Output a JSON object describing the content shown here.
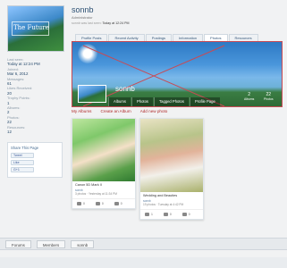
{
  "sidebar": {
    "avatar_text": "The Future",
    "stats": [
      {
        "label": "Last seen:",
        "value": "Today at 12:24 PM"
      },
      {
        "label": "Joined:",
        "value": "Mar 6, 2012"
      },
      {
        "label": "Messages:",
        "value": "61"
      },
      {
        "label": "Likes Received:",
        "value": "20"
      },
      {
        "label": "Trophy Points:",
        "value": "1"
      },
      {
        "label": "Albums:",
        "value": "2"
      },
      {
        "label": "Photos:",
        "value": "22"
      },
      {
        "label": "Resources:",
        "value": "12"
      }
    ],
    "share": {
      "title": "Share This Page",
      "buttons": [
        "Tweet",
        "Like",
        "G+1"
      ]
    }
  },
  "profile": {
    "username": "sonnb",
    "role": "Administrator",
    "last_seen_prefix": "sonnb was last seen:",
    "last_seen_value": "Today at 12:24 PM"
  },
  "tabs": [
    "Profile Posts",
    "Recent Activity",
    "Postings",
    "Information",
    "Photos",
    "Resources"
  ],
  "cover": {
    "username": "sonnb",
    "nav": [
      "Albums",
      "Photos",
      "Tagged Photos",
      "Profile Page"
    ],
    "stats": [
      {
        "number": "2",
        "label": "Albums"
      },
      {
        "number": "22",
        "label": "Photos"
      }
    ]
  },
  "actions": [
    "My Albums",
    "Create an Album",
    "Add new photo"
  ],
  "albums": [
    {
      "title": "Canon 5D Mark II",
      "owner": "sonnb",
      "meta": "3 photos · Yesterday at 11:34 PM",
      "likes": "0",
      "comments": "0",
      "views": "0"
    },
    {
      "title": "Wedding and Beauties",
      "owner": "sonnb",
      "meta": "19 photos · Tuesday at 4:42 PM",
      "likes": "1",
      "comments": "0",
      "views": "0"
    }
  ],
  "breadcrumb": [
    "Forums",
    "Members",
    "sonnb"
  ],
  "colors": {
    "accent": "#2c4f72",
    "cover_border": "#c84a54",
    "action_link": "#b02a2a"
  }
}
